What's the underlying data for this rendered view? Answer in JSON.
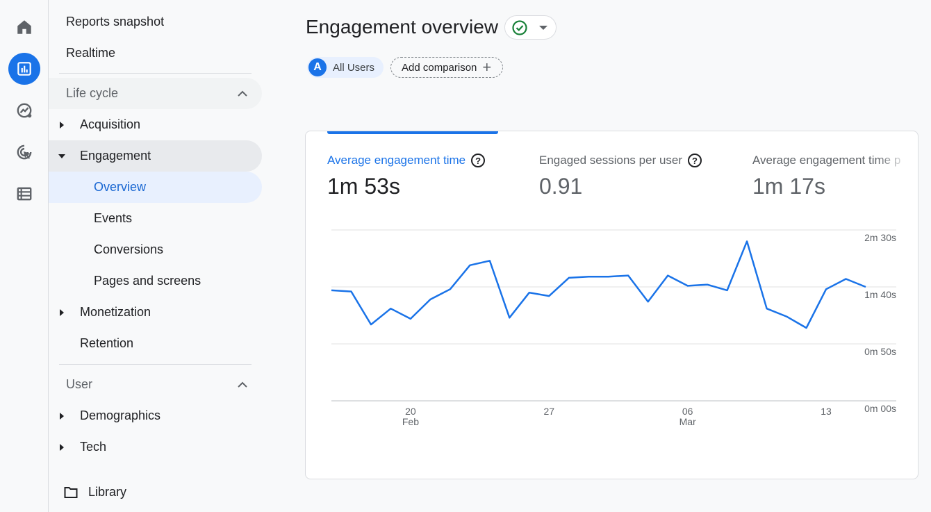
{
  "rail": {
    "items": [
      "home",
      "reports",
      "explore",
      "advertising",
      "configure"
    ]
  },
  "nav": {
    "reports_snapshot": "Reports snapshot",
    "realtime": "Realtime",
    "lifecycle": {
      "title": "Life cycle",
      "acquisition": "Acquisition",
      "engagement": "Engagement",
      "engagement_children": [
        "Overview",
        "Events",
        "Conversions",
        "Pages and screens"
      ],
      "monetization": "Monetization",
      "retention": "Retention"
    },
    "user": {
      "title": "User",
      "demographics": "Demographics",
      "tech": "Tech"
    },
    "library": "Library"
  },
  "header": {
    "title": "Engagement overview",
    "status": "verified",
    "comparison_chip": {
      "avatar": "A",
      "label": "All Users"
    },
    "add_comparison": "Add comparison",
    "add_icon": "+"
  },
  "metrics": [
    {
      "label": "Average engagement time",
      "value": "1m 53s",
      "help": "?"
    },
    {
      "label": "Engaged sessions per user",
      "value": "0.91",
      "help": "?"
    },
    {
      "label": "Average engagement time p",
      "value": "1m 17s"
    }
  ],
  "colors": {
    "accent": "#1a73e8",
    "line": "#1a73e8",
    "success": "#188038"
  },
  "chart_data": {
    "type": "line",
    "series": [
      {
        "values": [
          97,
          96,
          67,
          81,
          72,
          89,
          98,
          119,
          123,
          73,
          95,
          92,
          108,
          109,
          109,
          110,
          87,
          110,
          101,
          102,
          97,
          140,
          81,
          74,
          64,
          98,
          107,
          100
        ]
      }
    ],
    "y_unit": "seconds",
    "yticks": [
      "2m 30s",
      "1m 40s",
      "0m 50s",
      "0m 00s"
    ],
    "ylim": [
      0,
      150
    ],
    "xticks": [
      {
        "day": "20",
        "month": "Feb"
      },
      {
        "day": "27",
        "month": ""
      },
      {
        "day": "06",
        "month": "Mar"
      },
      {
        "day": "13",
        "month": ""
      }
    ],
    "grid": true
  }
}
